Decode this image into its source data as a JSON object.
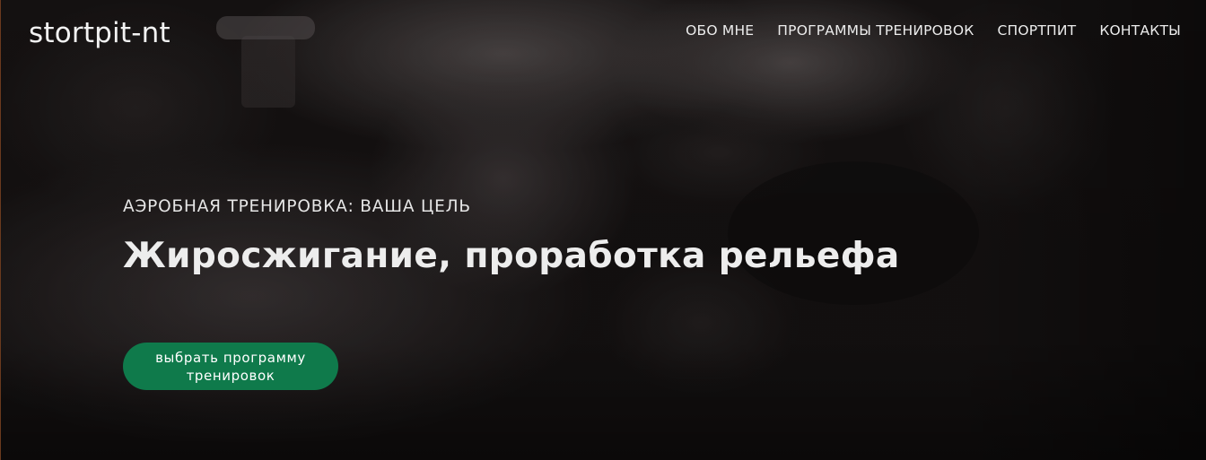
{
  "header": {
    "logo": "stortpit-nt",
    "nav": [
      {
        "label": "ОБО МНЕ"
      },
      {
        "label": "ПРОГРАММЫ ТРЕНИРОВОК"
      },
      {
        "label": "СПОРТПИТ"
      },
      {
        "label": "КОНТАКТЫ"
      }
    ]
  },
  "hero": {
    "subtitle": "АЭРОБНАЯ ТРЕНИРОВКА: ВАША ЦЕЛЬ",
    "headline": "Жиросжигание, проработка рельефа",
    "cta_label": "выбрать программу\nтренировок",
    "background_image": "dark-gym-photo",
    "cta_color": "#0f7a4b"
  }
}
